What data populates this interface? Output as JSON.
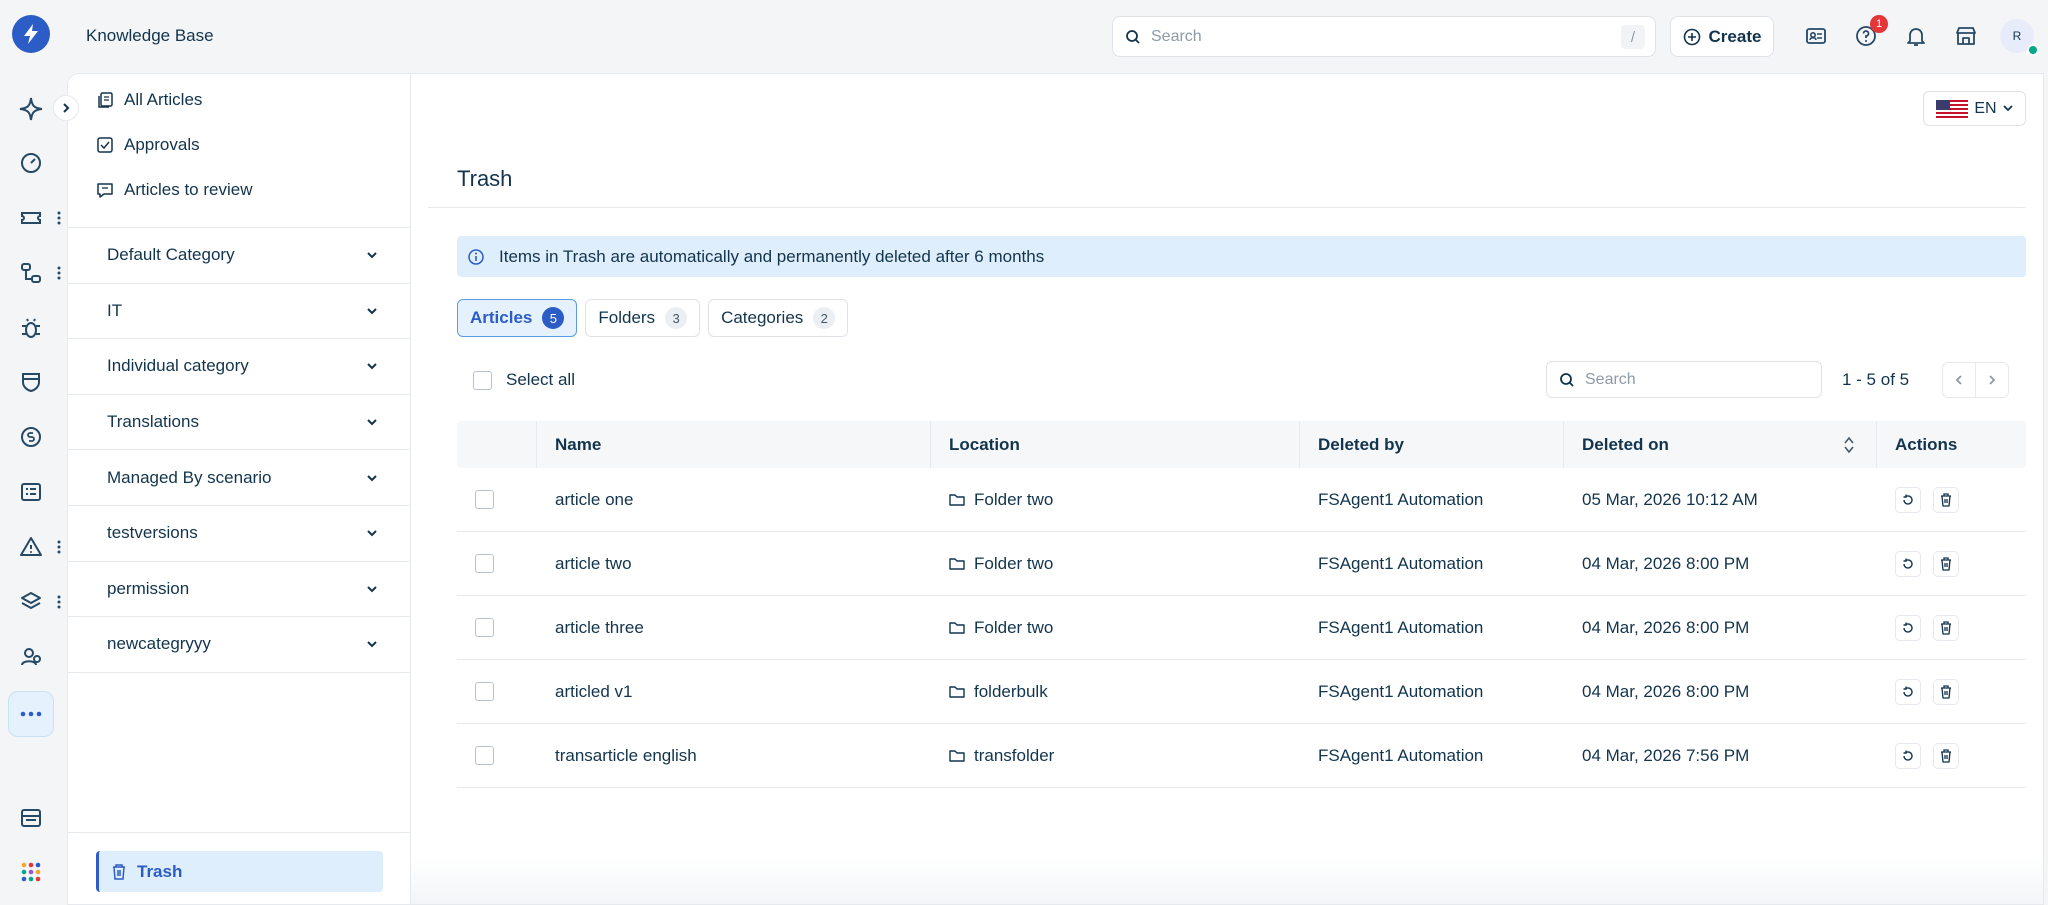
{
  "app": {
    "title": "Knowledge Base"
  },
  "topbar": {
    "search_placeholder": "Search",
    "search_shortcut": "/",
    "create_label": "Create",
    "notification_count": "1",
    "avatar_initial": "R"
  },
  "rail": {
    "icons": [
      "ai-sparkle-icon",
      "dashboard-icon",
      "tickets-icon",
      "workflow-icon",
      "bug-icon",
      "shield-icon",
      "dollar-icon",
      "tasks-icon",
      "alert-icon",
      "layers-icon",
      "team-icon",
      "more-icon",
      "inbox-icon",
      "apps-grid-icon"
    ]
  },
  "nav": {
    "links": [
      {
        "label": "All Articles",
        "icon": "articles-icon"
      },
      {
        "label": "Approvals",
        "icon": "checkbox-icon"
      },
      {
        "label": "Articles to review",
        "icon": "review-icon"
      }
    ],
    "categories": [
      "Default Category",
      "IT",
      "Individual category",
      "Translations",
      "Managed By scenario",
      "testversions",
      "permission",
      "newcategryyy"
    ],
    "trash_label": "Trash"
  },
  "content": {
    "language": "EN",
    "page_title": "Trash",
    "info_text": "Items in Trash are automatically and permanently deleted after 6 months",
    "tabs": [
      {
        "label": "Articles",
        "count": "5",
        "active": true
      },
      {
        "label": "Folders",
        "count": "3",
        "active": false
      },
      {
        "label": "Categories",
        "count": "2",
        "active": false
      }
    ],
    "select_all_label": "Select all",
    "table_search_placeholder": "Search",
    "pagination": "1 - 5 of 5",
    "columns": [
      "Name",
      "Location",
      "Deleted by",
      "Deleted on",
      "Actions"
    ],
    "rows": [
      {
        "name": "article one",
        "location": "Folder two",
        "deleted_by": "FSAgent1 Automation",
        "deleted_on": "05 Mar, 2026 10:12 AM"
      },
      {
        "name": "article two",
        "location": "Folder two",
        "deleted_by": "FSAgent1 Automation",
        "deleted_on": "04 Mar, 2026 8:00 PM"
      },
      {
        "name": "article three",
        "location": "Folder two",
        "deleted_by": "FSAgent1 Automation",
        "deleted_on": "04 Mar, 2026 8:00 PM"
      },
      {
        "name": "articled v1",
        "location": "folderbulk",
        "deleted_by": "FSAgent1 Automation",
        "deleted_on": "04 Mar, 2026 8:00 PM"
      },
      {
        "name": "transarticle english",
        "location": "transfolder",
        "deleted_by": "FSAgent1 Automation",
        "deleted_on": "04 Mar, 2026 7:56 PM"
      }
    ]
  },
  "colors": {
    "accent": "#2c5cc5",
    "info_bg": "#dfeefc",
    "badge": "#e43538",
    "online": "#00a886"
  }
}
